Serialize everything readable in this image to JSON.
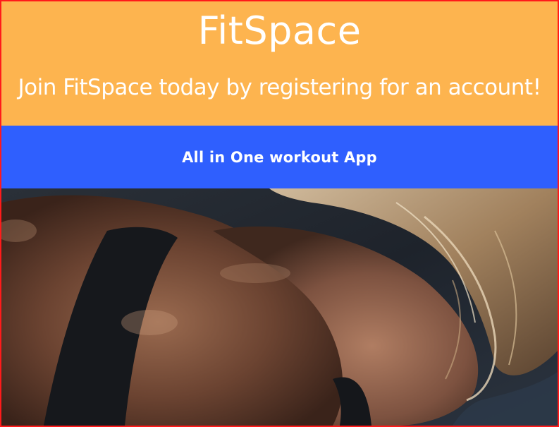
{
  "header": {
    "title": "FitSpace",
    "tagline": "Join FitSpace today by registering for an account!"
  },
  "banner": {
    "text": "All in One workout App"
  },
  "hero_image": {
    "subject": "athlete-photo"
  },
  "colors": {
    "header_bg": "#fdb44f",
    "banner_bg": "#2f5ffe",
    "border": "#ff1a1a",
    "text": "#ffffff"
  }
}
